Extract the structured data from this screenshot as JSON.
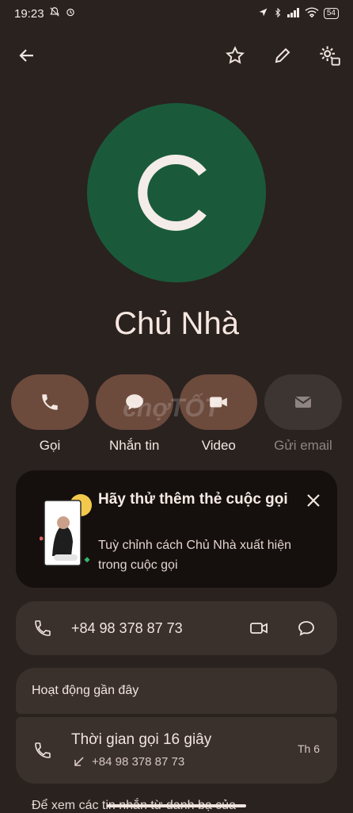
{
  "status_bar": {
    "time": "19:23",
    "battery": "54"
  },
  "contact": {
    "initial": "C",
    "name": "Chủ Nhà",
    "avatar_color": "#1a5a3a"
  },
  "actions": [
    {
      "label": "Gọi",
      "icon": "phone-icon"
    },
    {
      "label": "Nhắn tin",
      "icon": "message-icon"
    },
    {
      "label": "Video",
      "icon": "video-icon"
    },
    {
      "label": "Gửi email",
      "icon": "email-icon",
      "disabled": true
    }
  ],
  "watermark": "chợTỐT",
  "promo": {
    "title": "Hãy thử thêm thẻ cuộc gọi",
    "desc": "Tuỳ chỉnh cách Chủ Nhà xuất hiện trong cuộc gọi"
  },
  "phone": {
    "number": "+84 98 378 87 73"
  },
  "recent": {
    "header": "Hoạt động gần đây",
    "item_title": "Thời gian gọi 16 giây",
    "item_number": "+84 98 378 87 73",
    "item_day": "Th 6"
  },
  "bottom_text": "Để xem các tin nhắn từ danh bạ của"
}
